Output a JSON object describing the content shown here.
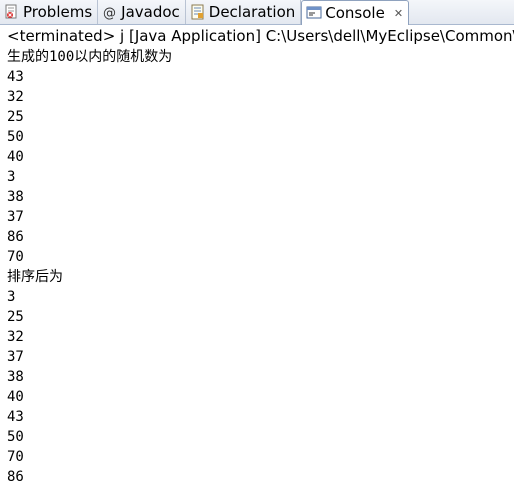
{
  "tabs": [
    {
      "label": "Problems",
      "icon": "problems-icon"
    },
    {
      "label": "Javadoc",
      "icon": "javadoc-icon"
    },
    {
      "label": "Declaration",
      "icon": "declaration-icon"
    },
    {
      "label": "Console",
      "icon": "console-icon",
      "active": true
    }
  ],
  "status": {
    "text": "<terminated> j [Java Application] C:\\Users\\dell\\MyEclipse\\Common\\b"
  },
  "console": {
    "lines": [
      "生成的100以内的随机数为",
      "43",
      "32",
      "25",
      "50",
      "40",
      "3",
      "38",
      "37",
      "86",
      "70",
      "排序后为",
      "3",
      "25",
      "32",
      "37",
      "38",
      "40",
      "43",
      "50",
      "70",
      "86"
    ]
  },
  "colors": {
    "tab_border": "#8fa2be",
    "tabbar_bg": "#e3e8f0"
  }
}
